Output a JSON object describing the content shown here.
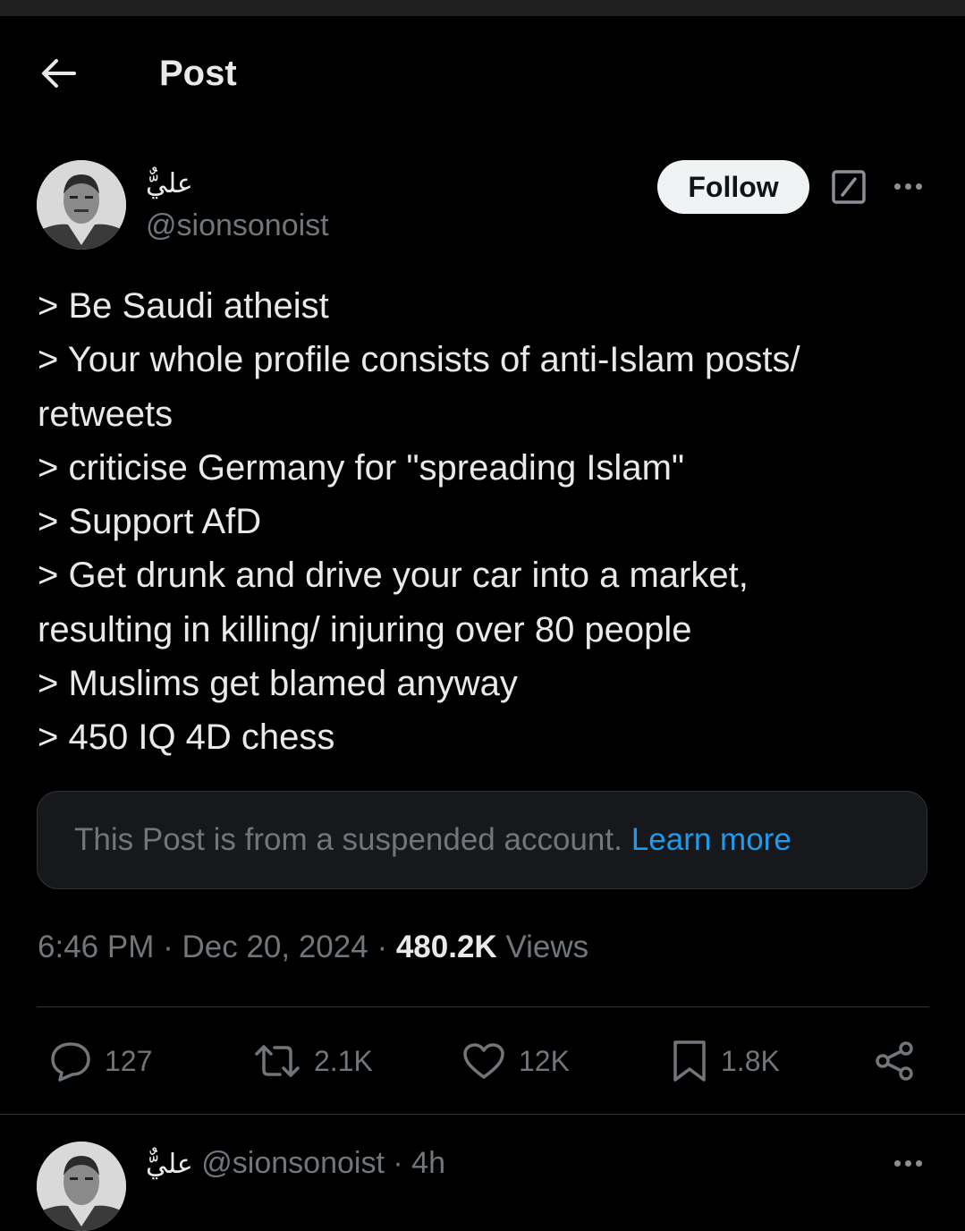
{
  "header": {
    "title": "Post",
    "back_icon": "arrow-left-icon"
  },
  "post": {
    "author_name": "عليٌّ",
    "author_handle": "@sionsonoist",
    "follow_label": "Follow",
    "lines": [
      "> Be Saudi atheist",
      "> Your whole profile consists of anti-Islam posts/",
      "retweets",
      "> criticise Germany for \"spreading Islam\"",
      "> Support AfD",
      "> Get drunk and drive your car into a market,",
      "resulting in killing/ injuring over 80 people",
      "> Muslims get blamed anyway",
      "> 450 IQ 4D chess"
    ],
    "notice_text": "This Post is from a suspended account.",
    "notice_link": "Learn more",
    "time": "6:46 PM",
    "date": "Dec 20, 2024",
    "views_count": "480.2K",
    "views_label": "Views",
    "separator": "·"
  },
  "actions": {
    "replies": "127",
    "reposts": "2.1K",
    "likes": "12K",
    "bookmarks": "1.8K"
  },
  "next_post": {
    "author_name": "عليٌّ",
    "author_handle": "@sionsonoist",
    "separator": "·",
    "age": "4h"
  },
  "colors": {
    "background": "#000000",
    "text": "#e7e9ea",
    "muted": "#71767b",
    "link": "#1d9bf0",
    "divider": "#2f3336"
  }
}
